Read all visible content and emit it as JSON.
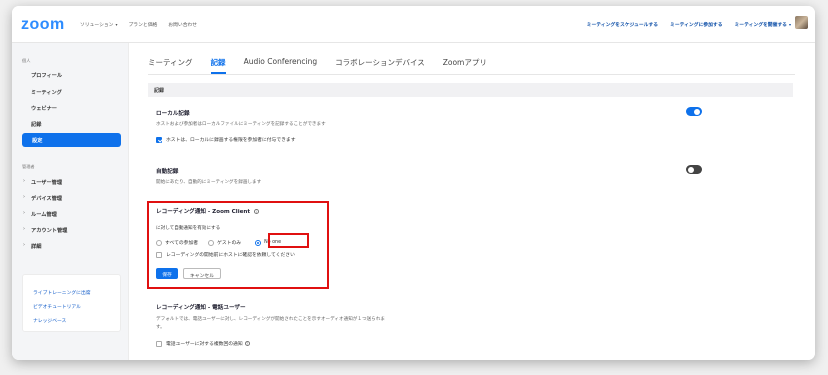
{
  "brand": {
    "logo": "zoom",
    "color": "#2d8cff"
  },
  "topnav": {
    "left": [
      {
        "label": "ソリューション",
        "caret": "▾"
      },
      {
        "label": "プランと価格"
      },
      {
        "label": "お問い合わせ"
      }
    ],
    "right": [
      {
        "label": "ミーティングをスケジュールする"
      },
      {
        "label": "ミーティングに参加する"
      },
      {
        "label": "ミーティングを開催する",
        "caret": "▾"
      }
    ]
  },
  "sidebar": {
    "personal_heading": "個人",
    "personal_items": [
      "プロフィール",
      "ミーティング",
      "ウェビナー",
      "記録",
      "設定"
    ],
    "active_item": "設定",
    "admin_heading": "管理者",
    "admin_items": [
      "ユーザー管理",
      "デバイス管理",
      "ルーム管理",
      "アカウント管理",
      "詳細"
    ],
    "help_links": [
      "ライブトレーニングに出席",
      "ビデオチュートリアル",
      "ナレッジベース"
    ]
  },
  "tabs": [
    "ミーティング",
    "記録",
    "Audio Conferencing",
    "コラボレーションデバイス",
    "Zoomアプリ"
  ],
  "active_tab": "記録",
  "section_title": "記録",
  "local_recording": {
    "title": "ローカル記録",
    "desc": "ホストおよび参加者はローカルファイルにミーティングを記録することができます",
    "option": "ホストは、ローカルに録画する権限を参加者に付与できます",
    "enabled": true
  },
  "auto_recording": {
    "title": "自動記録",
    "desc": "開始にあたり、自動的にミーティングを録画します",
    "enabled": false
  },
  "notify_client": {
    "title": "レコーディング通知 - Zoom Client",
    "info": "i",
    "prompt": "に対して自動通知を有効にする",
    "radio_options": [
      "すべての参加者",
      "ゲストのみ",
      "No one"
    ],
    "selected": "No one",
    "checkbox": "レコーディングの開始前にホストに確認を依頼してください",
    "save": "保存",
    "cancel": "キャンセル"
  },
  "notify_phone": {
    "title": "レコーディング通知 - 電話ユーザー",
    "desc_line1": "デフォルトでは、電話ユーザーに対し、レコーディングが開始されたことを示すオーディオ通知が１つ送られま",
    "desc_line2": "す。",
    "option": "電話ユーザーに対する複数回の通知",
    "info": "?"
  }
}
